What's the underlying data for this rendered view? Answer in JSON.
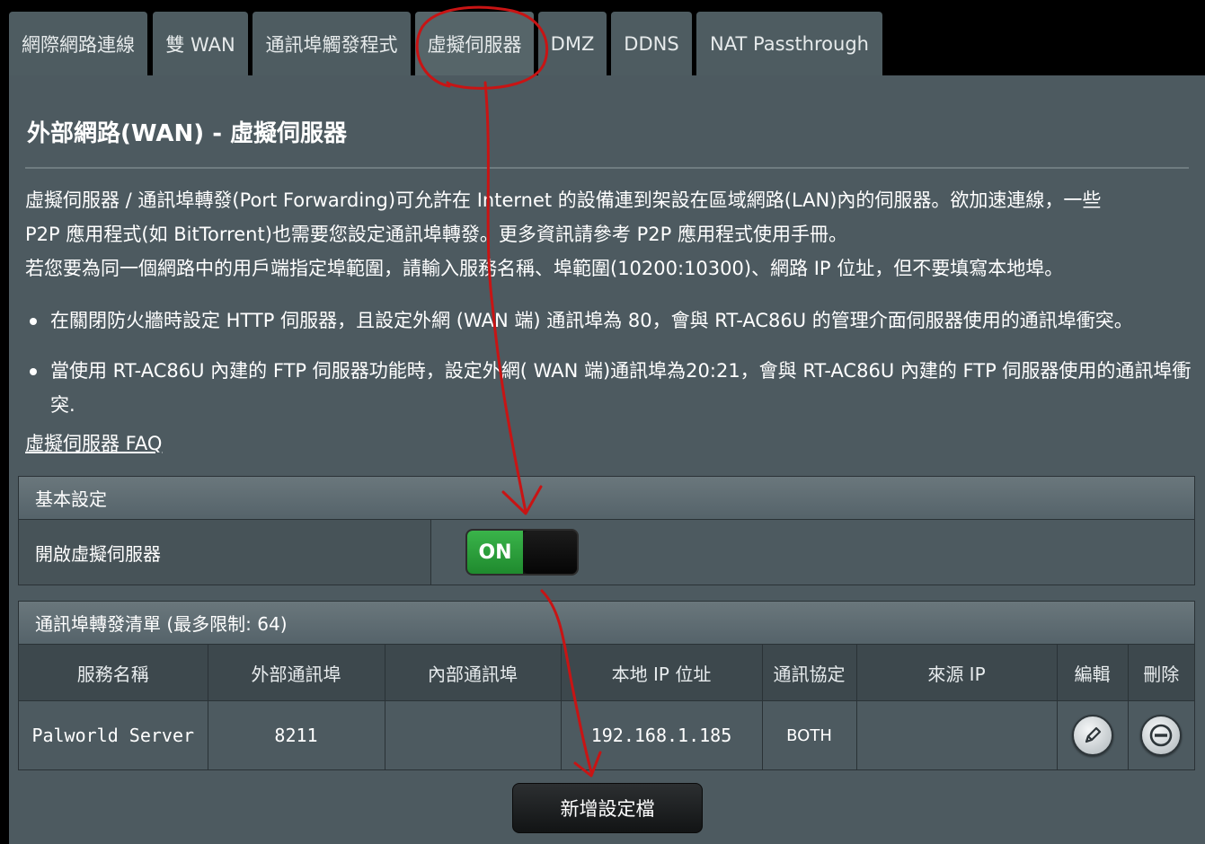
{
  "tabs": [
    {
      "label": "網際網路連線"
    },
    {
      "label": "雙 WAN"
    },
    {
      "label": "通訊埠觸發程式"
    },
    {
      "label": "虛擬伺服器"
    },
    {
      "label": "DMZ"
    },
    {
      "label": "DDNS"
    },
    {
      "label": "NAT Passthrough"
    }
  ],
  "page": {
    "title": "外部網路(WAN) - 虛擬伺服器",
    "desc_lines": [
      "虛擬伺服器 / 通訊埠轉發(Port Forwarding)可允許在 Internet 的設備連到架設在區域網路(LAN)內的伺服器。欲加速連線，一些",
      "P2P 應用程式(如 BitTorrent)也需要您設定通訊埠轉發。更多資訊請參考 P2P 應用程式使用手冊。",
      "若您要為同一個網路中的用戶端指定埠範圍，請輸入服務名稱、埠範圍(10200:10300)、網路 IP 位址，但不要填寫本地埠。"
    ],
    "bullets": [
      "在關閉防火牆時設定 HTTP 伺服器，且設定外網 (WAN 端) 通訊埠為 80，會與 RT-AC86U 的管理介面伺服器使用的通訊埠衝突。",
      "當使用 RT-AC86U 內建的 FTP 伺服器功能時，設定外網( WAN 端)通訊埠為20:21，會與 RT-AC86U 內建的 FTP 伺服器使用的通訊埠衝突."
    ],
    "faq_link": "虛擬伺服器  FAQ"
  },
  "basic": {
    "header": "基本設定",
    "enable_label": "開啟虛擬伺服器",
    "toggle_state": "ON"
  },
  "list": {
    "header": "通訊埠轉發清單 (最多限制: 64)",
    "columns": [
      "服務名稱",
      "外部通訊埠",
      "內部通訊埠",
      "本地 IP 位址",
      "通訊協定",
      "來源 IP",
      "編輯",
      "刪除"
    ],
    "rows": [
      {
        "service": "Palworld Server",
        "external_port": "8211",
        "internal_port": "",
        "local_ip": "192.168.1.185",
        "protocol": "BOTH",
        "source_ip": ""
      }
    ]
  },
  "add_button": "新增設定檔",
  "colors": {
    "panel": "#4d5a60",
    "toggle_on": "#2ea03c",
    "annotation": "#c81414"
  },
  "icons": {
    "edit": "pencil-icon",
    "delete": "minus-circle-icon"
  }
}
